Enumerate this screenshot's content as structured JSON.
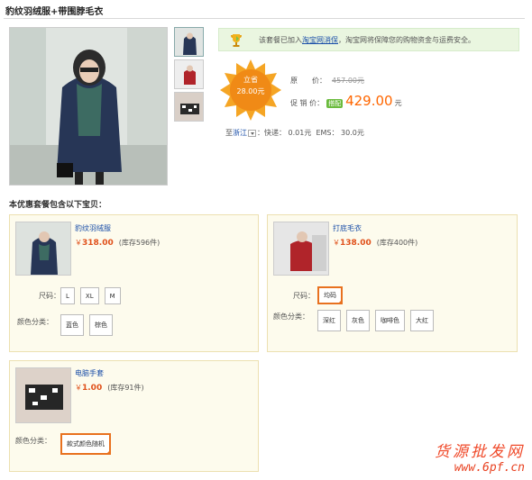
{
  "page_title": "豹纹羽绒服+带围脖毛衣",
  "safe_notice": {
    "text_before": "该套餐已加入",
    "link": "淘宝网消保",
    "text_after": "，淘宝网将保障您的购物资金与运费安全。"
  },
  "promo_badge": {
    "line1": "立省",
    "line2": "28.00元"
  },
  "prices": {
    "original_label": "原　　价：",
    "original_value": "457.00元",
    "promo_label": "促 销 价：",
    "promo_tag": "搭配",
    "promo_value": "429.00",
    "unit": "元"
  },
  "shipping": {
    "to": "至",
    "region": "浙江",
    "express": "：快递： 0.01元",
    "ems": "EMS： 30.0元"
  },
  "section_title": "本优惠套餐包含以下宝贝：",
  "items": [
    {
      "name": "豹纹羽绒服",
      "currency": "￥",
      "price": "318.00",
      "stock": "(库存596件)",
      "size_label": "尺码：",
      "sizes": [
        "L",
        "XL",
        "M"
      ],
      "color_label": "颜色分类：",
      "colors": [
        "蓝色",
        "棕色"
      ]
    },
    {
      "name": "打底毛衣",
      "currency": "￥",
      "price": "138.00",
      "stock": "(库存400件)",
      "size_label": "尺码：",
      "sizes": [
        "均码"
      ],
      "color_label": "颜色分类：",
      "colors": [
        "深红",
        "灰色",
        "咖啡色",
        "大红"
      ]
    },
    {
      "name": "电脑手套",
      "currency": "￥",
      "price": "1.00",
      "stock": "(库存91件)",
      "color_label": "颜色分类：",
      "colors": [
        "款式颜色随机"
      ]
    }
  ],
  "watermark": {
    "title": "货源批发网",
    "url": "www.6pf.cn"
  },
  "colors": {
    "accent_orange": "#e8711f",
    "price_red": "#e0501a",
    "link_blue": "#1a4ea8",
    "card_bg": "#fdfbed"
  },
  "icons": [
    "trophy-icon",
    "dropdown-arrow-icon",
    "starburst-badge"
  ]
}
